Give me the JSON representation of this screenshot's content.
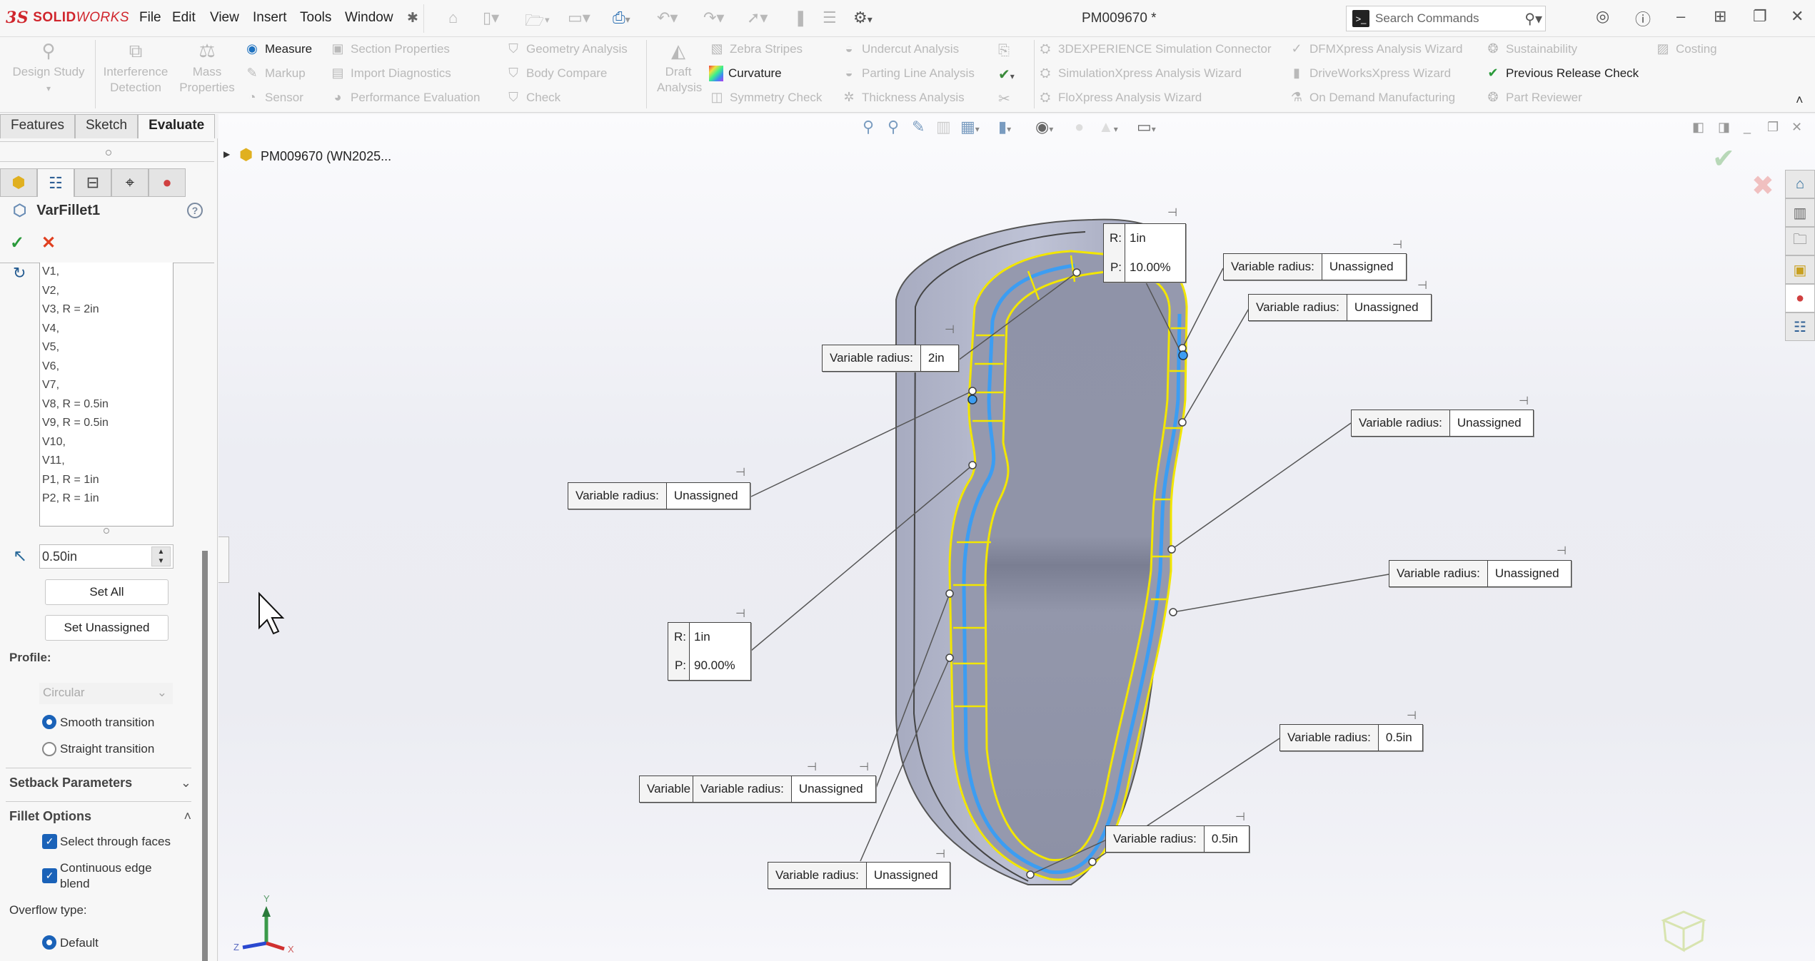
{
  "app": {
    "brand": "SOLIDWORKS",
    "brand_prefix": "3S",
    "brand_solid": "SOLID",
    "brand_works": "WORKS",
    "document_title": "PM009670 *"
  },
  "menu": [
    "File",
    "Edit",
    "View",
    "Insert",
    "Tools",
    "Window"
  ],
  "search": {
    "placeholder": "Search Commands"
  },
  "ribbon": {
    "big": [
      {
        "label": "Design Study",
        "icon": "design-study-icon"
      },
      {
        "label": "Interference Detection",
        "icon": "interference-icon"
      },
      {
        "label": "Mass Properties",
        "icon": "mass-properties-icon"
      },
      {
        "label": "Draft Analysis",
        "icon": "draft-analysis-icon"
      }
    ],
    "col1": [
      "Measure",
      "Markup",
      "Sensor"
    ],
    "col2": [
      "Section Properties",
      "Import Diagnostics",
      "Performance Evaluation"
    ],
    "col3": [
      "Geometry Analysis",
      "Body Compare",
      "Check"
    ],
    "col4": [
      "Zebra Stripes",
      "Curvature",
      "Symmetry Check"
    ],
    "col5": [
      "Undercut Analysis",
      "Parting Line Analysis",
      "Thickness Analysis"
    ],
    "col6": [
      "3DEXPERIENCE Simulation Connector",
      "SimulationXpress Analysis Wizard",
      "FloXpress Analysis Wizard"
    ],
    "col7": [
      "DFMXpress Analysis Wizard",
      "DriveWorksXpress Wizard",
      "On Demand Manufacturing"
    ],
    "col8": [
      "Sustainability",
      "Previous Release Check",
      "Part Reviewer"
    ],
    "col9": [
      "Costing"
    ]
  },
  "tabs": [
    {
      "label": "Features"
    },
    {
      "label": "Sketch"
    },
    {
      "label": "Evaluate",
      "active": true
    }
  ],
  "property_manager": {
    "title": "VarFillet1",
    "help": "?",
    "ok": "✓",
    "cancel": "✕",
    "vertex_list": [
      "V1,",
      "V2,",
      "V3, R = 2in",
      "V4,",
      "V5,",
      "V6,",
      "V7,",
      "V8, R = 0.5in",
      "V9, R = 0.5in",
      "V10,",
      "V11,",
      "P1, R = 1in",
      "P2, R = 1in"
    ],
    "radius_value": "0.50in",
    "set_all": "Set All",
    "set_unassigned": "Set Unassigned",
    "profile_label": "Profile:",
    "profile_value": "Circular",
    "smooth_transition": "Smooth transition",
    "straight_transition": "Straight transition",
    "transition_selected": "Smooth transition",
    "setback_section": "Setback Parameters",
    "fillet_options_section": "Fillet Options",
    "select_through_faces": "Select through faces",
    "select_through_faces_checked": true,
    "continuous_edge_blend": "Continuous edge blend",
    "continuous_edge_blend_checked": true,
    "overflow_label": "Overflow type:",
    "overflow_default": "Default"
  },
  "tree": {
    "root": "PM009670 (WN2025..."
  },
  "callouts": [
    {
      "label": "Variable radius:",
      "value": "2in"
    },
    {
      "label": "Variable radius:",
      "value": "Unassigned"
    },
    {
      "label": "Variable radius:",
      "value": "Unassigned"
    },
    {
      "label": "Variable radius:",
      "value": "Unassigned"
    },
    {
      "label": "Variable radius:",
      "value": "Unassigned"
    },
    {
      "label": "Variable radius:",
      "value": "Unassigned"
    },
    {
      "label": "Variable radius:",
      "value": "Unassigned"
    },
    {
      "label": "Variable radius:",
      "value": "Unassigned"
    },
    {
      "label": "Variable radius:",
      "value": "0.5in"
    },
    {
      "label": "Variable radius:",
      "value": "0.5in"
    },
    {
      "label": "Variable",
      "value": ""
    }
  ],
  "point_callouts": [
    {
      "r_label": "R:",
      "r": "1in",
      "p_label": "P:",
      "p": "10.00%"
    },
    {
      "r_label": "R:",
      "r": "1in",
      "p_label": "P:",
      "p": "90.00%"
    }
  ],
  "triad": {
    "x": "X",
    "y": "Y",
    "z": "Z"
  },
  "colors": {
    "accent": "#1a62b8",
    "fillet_preview": "#f2e600",
    "selected_edge": "#3c9df2",
    "brand": "#d0252c"
  }
}
